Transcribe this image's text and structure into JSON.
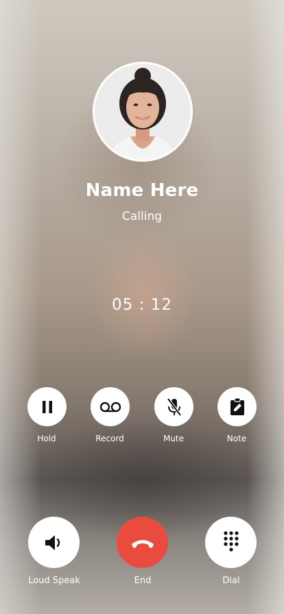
{
  "contact": {
    "name": "Name Here",
    "status": "Calling"
  },
  "call": {
    "timer": "05 : 12"
  },
  "controls": [
    {
      "label": "Hold",
      "icon": "pause-icon"
    },
    {
      "label": "Record",
      "icon": "voicemail-icon"
    },
    {
      "label": "Mute",
      "icon": "mic-off-icon"
    },
    {
      "label": "Note",
      "icon": "note-icon"
    }
  ],
  "actions": [
    {
      "label": "Loud Speak",
      "icon": "speaker-icon"
    },
    {
      "label": "End",
      "icon": "hang-up-icon"
    },
    {
      "label": "Dial",
      "icon": "dialpad-icon"
    }
  ],
  "colors": {
    "end": "#e94c3f",
    "button": "#ffffff"
  }
}
